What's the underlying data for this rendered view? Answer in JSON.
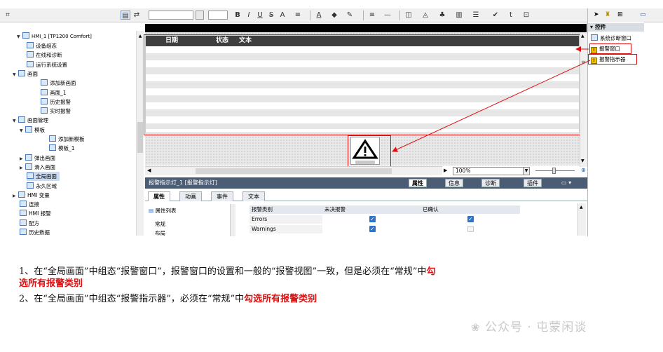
{
  "toolbar": {
    "buttons": [
      "B",
      "I",
      "U",
      "S",
      "A",
      "≡",
      "A",
      "◆",
      "✎",
      "≡",
      "—",
      "◫",
      "◬",
      "♣",
      "▥",
      "☰",
      "✔",
      "t",
      "⊡"
    ]
  },
  "tree": {
    "root": "HMI_1 [TP1200 Comfort]",
    "items": [
      {
        "label": "设备组态",
        "level": 2
      },
      {
        "label": "在线和诊断",
        "level": 2
      },
      {
        "label": "运行系统设置",
        "level": 2
      },
      {
        "label": "画面",
        "level": 1,
        "expanded": true
      },
      {
        "label": "添加新画面",
        "level": 3
      },
      {
        "label": "画面_1",
        "level": 3
      },
      {
        "label": "历史报警",
        "level": 3
      },
      {
        "label": "实时报警",
        "level": 3
      },
      {
        "label": "画面管理",
        "level": 1,
        "expanded": true
      },
      {
        "label": "模板",
        "level": 2,
        "expanded": true
      },
      {
        "label": "添加新模板",
        "level": 4
      },
      {
        "label": "模板_1",
        "level": 4
      },
      {
        "label": "弹出画面",
        "level": 2,
        "expanded": false
      },
      {
        "label": "滑入画面",
        "level": 2,
        "expanded": false
      },
      {
        "label": "全局画面",
        "level": 2,
        "selected": true
      },
      {
        "label": "永久区域",
        "level": 2
      },
      {
        "label": "HMI 变量",
        "level": 1,
        "expanded": false
      },
      {
        "label": "连接",
        "level": 1
      },
      {
        "label": "HMI 报警",
        "level": 1
      },
      {
        "label": "配方",
        "level": 1
      },
      {
        "label": "历史数据",
        "level": 1
      }
    ]
  },
  "alarm_view": {
    "headers": [
      "日期",
      "状态",
      "文本"
    ]
  },
  "zoom": "100%",
  "inspector": {
    "title": "报警指示灯_1 [报警指示灯]",
    "tabs": [
      "属性",
      "信息",
      "诊断",
      "插件"
    ],
    "prop_tabs": [
      "属性",
      "动画",
      "事件",
      "文本"
    ],
    "prop_list_label": "属性列表",
    "prop_items": [
      "常规",
      "布局"
    ],
    "grid_headers": [
      "报警类别",
      "未决报警",
      "已确认"
    ],
    "grid_rows": [
      {
        "name": "Errors",
        "pending": true,
        "acked": true
      },
      {
        "name": "Warnings",
        "pending": true,
        "acked": false
      }
    ]
  },
  "right_panel": {
    "title": "控件",
    "items": [
      "系统诊断窗口",
      "报警窗口",
      "报警指示器"
    ]
  },
  "notes": {
    "line1_prefix": "1、在“全局画面”中组态“报警窗口”，报警窗口的设置和一般的“报警视图”一致，但是必须在“常规”中",
    "line1_red_a": "勾",
    "line1_red_b": "选所有报警类别",
    "line2_prefix": "2、在“全局画面”中组态“报警指示器”，必须在“常规”中",
    "line2_red": "勾选所有报警类别"
  },
  "watermark": "公众号 · 屯蒙闲谈",
  "colors": {
    "highlight": "#e01010",
    "accent": "#2f73c7"
  }
}
